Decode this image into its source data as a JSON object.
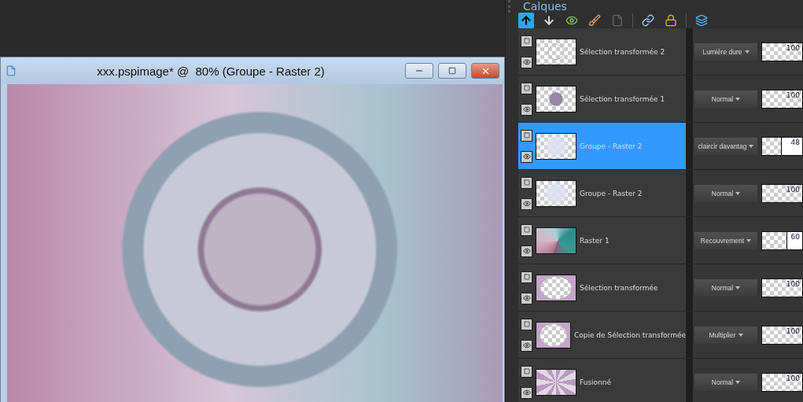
{
  "document_window": {
    "title": "xxx.pspimage* @  80% (Groupe - Raster 2)"
  },
  "layers_panel": {
    "title": "Calques",
    "layers": [
      {
        "name": "Sélection transformée 2",
        "kind": "outline",
        "blend": "Lumière dure",
        "opacity": "100",
        "level": 1,
        "selected": false
      },
      {
        "name": "Sélection transformée 1",
        "kind": "disc",
        "blend": "Normal",
        "opacity": "100",
        "level": 1,
        "selected": false
      },
      {
        "name": "Groupe - Raster 2",
        "kind": "haze",
        "blend": "claircir davantag",
        "opacity": "48",
        "level": 0.48,
        "selected": true
      },
      {
        "name": "Groupe - Raster 2",
        "kind": "haze",
        "blend": "Normal",
        "opacity": "100",
        "level": 1,
        "selected": false
      },
      {
        "name": "Raster 1",
        "kind": "gradient",
        "blend": "Recouvrement",
        "opacity": "60",
        "level": 0.6,
        "selected": false
      },
      {
        "name": "Sélection transformée",
        "kind": "frame",
        "blend": "Normal",
        "opacity": "100",
        "level": 1,
        "selected": false
      },
      {
        "name": "Copie de Sélection transformée",
        "kind": "frame",
        "blend": "Multiplier",
        "opacity": "100",
        "level": 1,
        "selected": false
      },
      {
        "name": "Fusionné",
        "kind": "swirl",
        "blend": "Normal",
        "opacity": "100",
        "level": 1,
        "selected": false
      }
    ]
  }
}
